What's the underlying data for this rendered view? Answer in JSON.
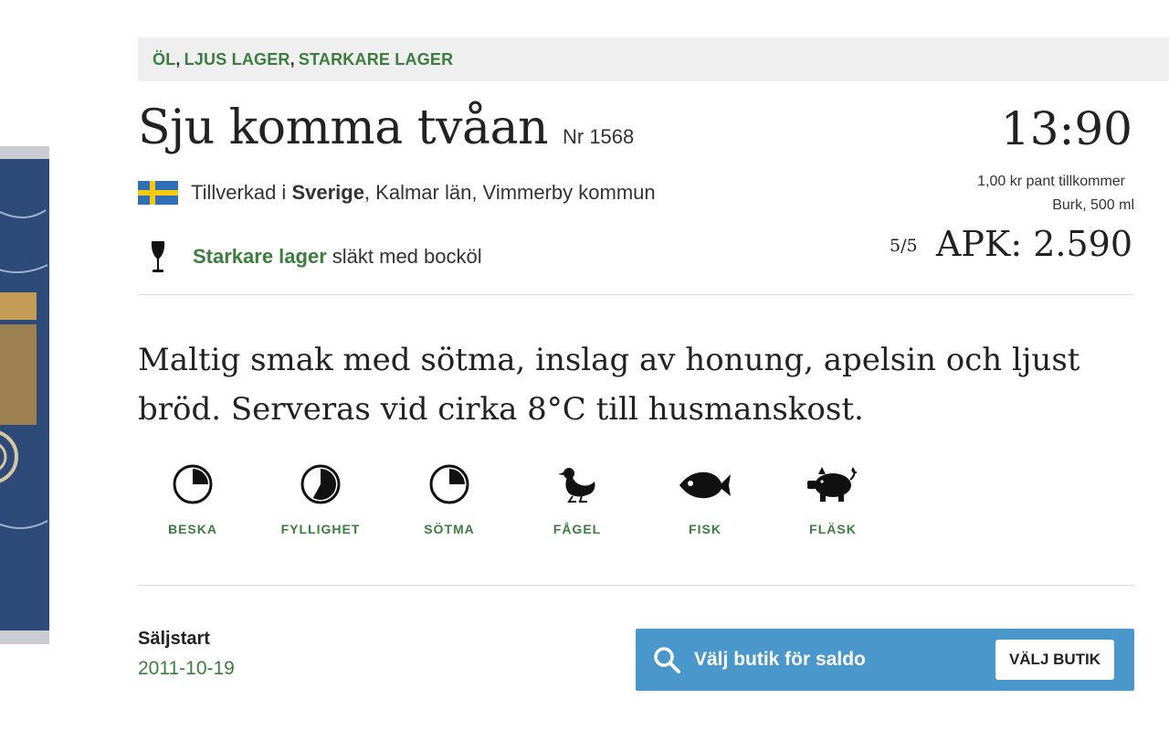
{
  "breadcrumb": [
    {
      "label": "ÖL"
    },
    {
      "label": "LJUS LAGER"
    },
    {
      "label": "STARKARE LAGER"
    }
  ],
  "product": {
    "name": "Sju komma tvåan",
    "number": "Nr 1568",
    "price": "13:90",
    "deposit": "1,00 kr pant tillkommer",
    "package": "Burk, 500 ml",
    "origin_prefix": "Tillverkad i",
    "origin_country": "Sverige",
    "origin_rest": ", Kalmar län, Vimmerby kommun",
    "style_name": "Starkare lager",
    "style_rest": "släkt med bocköl",
    "rating": "5/5",
    "apk": "APK: 2.590",
    "description": "Maltig smak med sötma, inslag av honung, apelsin och ljust bröd. Serveras vid cirka 8°C till husmanskost."
  },
  "taste_profile": [
    {
      "label": "BESKA",
      "icon": "clock-pie-icon",
      "fill": 0.25
    },
    {
      "label": "FYLLIGHET",
      "icon": "clock-pie-icon",
      "fill": 0.58
    },
    {
      "label": "SÖTMA",
      "icon": "clock-pie-icon",
      "fill": 0.25
    }
  ],
  "food_pairings": [
    {
      "label": "FÅGEL",
      "icon": "bird-icon"
    },
    {
      "label": "FISK",
      "icon": "fish-icon"
    },
    {
      "label": "FLÄSK",
      "icon": "pig-icon"
    }
  ],
  "sales_start": {
    "label": "Säljstart",
    "date": "2011-10-19"
  },
  "store": {
    "text": "Välj butik för saldo",
    "button": "VÄLJ BUTIK"
  },
  "colors": {
    "accent_green": "#3a7d3e",
    "store_blue": "#4a97cb",
    "flag_blue": "#2f6fb5",
    "flag_yellow": "#f6c80f"
  }
}
